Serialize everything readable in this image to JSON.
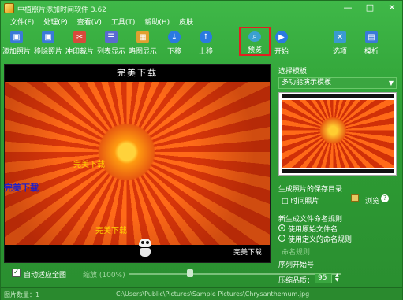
{
  "window": {
    "title": "中植照片添加时间软件 3.62",
    "controls": [
      "—",
      "□",
      "✕"
    ]
  },
  "menu": [
    "文件(F)",
    "处理(P)",
    "查看(V)",
    "工具(T)",
    "帮助(H)",
    "皮肤"
  ],
  "toolbar": [
    {
      "label": "添加照片",
      "icon": "add-photo-icon",
      "color": "#3a7ad8"
    },
    {
      "label": "移除照片",
      "icon": "remove-photo-icon",
      "color": "#3a7ad8"
    },
    {
      "label": "冲印裁片",
      "icon": "print-crop-icon",
      "color": "#d84a3a"
    },
    {
      "label": "列表显示",
      "icon": "list-view-icon",
      "color": "#5a6ad0"
    },
    {
      "label": "略图显示",
      "icon": "thumbnail-view-icon",
      "color": "#e0a030"
    },
    {
      "label": "下移",
      "icon": "move-down-icon",
      "color": "#2a7ae0"
    },
    {
      "label": "上移",
      "icon": "move-up-icon",
      "color": "#2a7ae0"
    },
    {
      "label": "预览",
      "icon": "preview-icon",
      "color": "#3aa0d0"
    },
    {
      "label": "开始",
      "icon": "start-icon",
      "color": "#2a7ae0"
    },
    {
      "label": "选项",
      "icon": "options-icon",
      "color": "#3a9ad0"
    },
    {
      "label": "模析",
      "icon": "template-icon",
      "color": "#3a7ad8"
    }
  ],
  "preview": {
    "watermark_top": "完美下载",
    "watermark_a": "完美下载",
    "watermark_b": "完美下载",
    "watermark_c": "完美下载",
    "watermark_bottom_right": "完美下载"
  },
  "controls": {
    "auto_fit_label": "自动适应全图",
    "auto_fit_checked": true,
    "zoom_label": "缩放 (100%)"
  },
  "status": {
    "photo_count": "图片数量：1",
    "path": "C:\\Users\\Public\\Pictures\\Sample Pictures\\Chrysanthemum.jpg"
  },
  "right_panel": {
    "template_heading": "选择模板",
    "template_value": "多功能演示模板",
    "save_dir_heading": "生成照片的保存目录",
    "save_dir_value": "□ 时间照片",
    "browse_label": "浏览",
    "filename_heading": "新生成文件命名规则",
    "radio_original": "使用原始文件名",
    "radio_custom": "使用定义的命名规则",
    "custom_rule_placeholder": "命名规则",
    "start_seq_label": "序列开始号",
    "quality_label": "压缩品质：",
    "quality_value": "95"
  }
}
